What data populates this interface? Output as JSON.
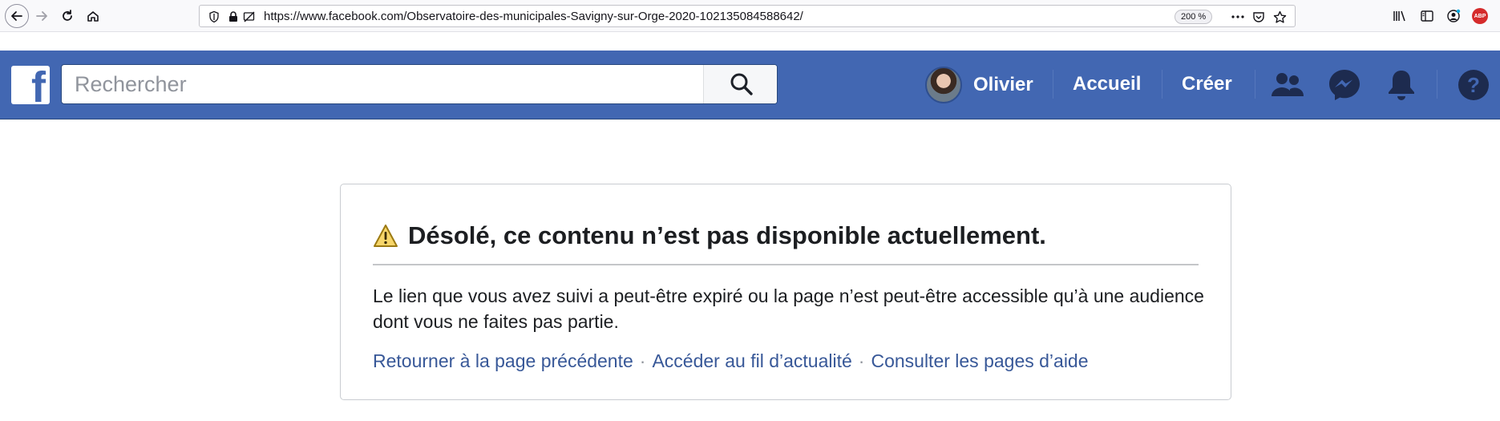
{
  "browser": {
    "url": "https://www.facebook.com/Observatoire-des-municipales-Savigny-sur-Orge-2020-102135084588642/",
    "zoom": "200 %",
    "icons": [
      "back-icon",
      "forward-icon",
      "reload-icon",
      "home-icon",
      "shield-icon",
      "lock-icon",
      "permissions-icon",
      "more-icon",
      "pocket-icon",
      "star-icon",
      "library-icon",
      "sidebar-icon",
      "account-icon"
    ],
    "adblock_badge": "ABP"
  },
  "header": {
    "logo": "f",
    "search_placeholder": "Rechercher",
    "profile_name": "Olivier",
    "nav": {
      "home": "Accueil",
      "create": "Créer"
    },
    "icons": [
      "friends-icon",
      "messenger-icon",
      "notifications-icon",
      "help-icon"
    ],
    "brand_color": "#4267b2"
  },
  "error": {
    "title": "Désolé, ce contenu n’est pas disponible actuellement.",
    "body": "Le lien que vous avez suivi a peut-être expiré ou la page n’est peut-être accessible qu’à une audience dont vous ne faites pas partie.",
    "links": {
      "back": "Retourner à la page précédente",
      "feed": "Accéder au fil d’actualité",
      "help": "Consulter les pages d’aide"
    },
    "separator": "·",
    "link_color": "#385898"
  }
}
